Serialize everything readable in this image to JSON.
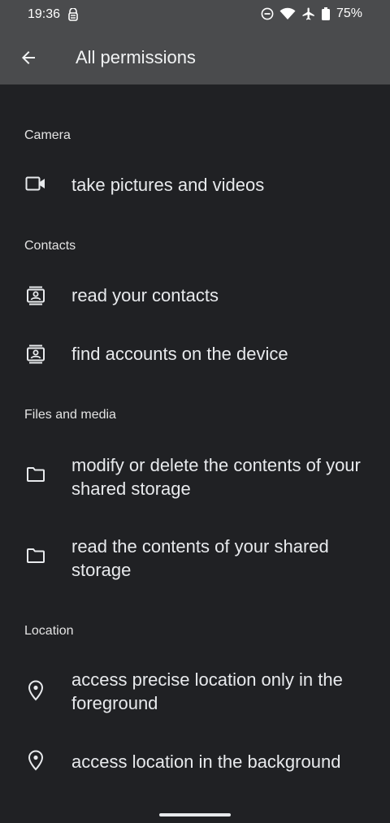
{
  "status_bar": {
    "time": "19:36",
    "battery_percent": "75%",
    "icons": [
      "vpn-icon",
      "do-not-disturb-icon",
      "wifi-icon",
      "airplane-icon",
      "battery-icon"
    ]
  },
  "app_bar": {
    "title": "All permissions",
    "back_icon": "arrow-back-icon"
  },
  "sections": {
    "camera": {
      "header": "Camera",
      "items": [
        {
          "icon": "videocam-icon",
          "label": "take pictures and videos"
        }
      ]
    },
    "contacts": {
      "header": "Contacts",
      "items": [
        {
          "icon": "contacts-icon",
          "label": "read your contacts"
        },
        {
          "icon": "contacts-icon",
          "label": "find accounts on the device"
        }
      ]
    },
    "files": {
      "header": "Files and media",
      "items": [
        {
          "icon": "folder-icon",
          "label": "modify or delete the contents of your shared storage"
        },
        {
          "icon": "folder-icon",
          "label": "read the contents of your shared storage"
        }
      ]
    },
    "location": {
      "header": "Location",
      "items": [
        {
          "icon": "location-pin-icon",
          "label": "access precise location only in the foreground"
        },
        {
          "icon": "location-pin-icon",
          "label": "access location in the background"
        }
      ]
    }
  },
  "colors": {
    "background": "#202124",
    "app_bar": "#4a4b4d",
    "text": "#e8eaed"
  }
}
